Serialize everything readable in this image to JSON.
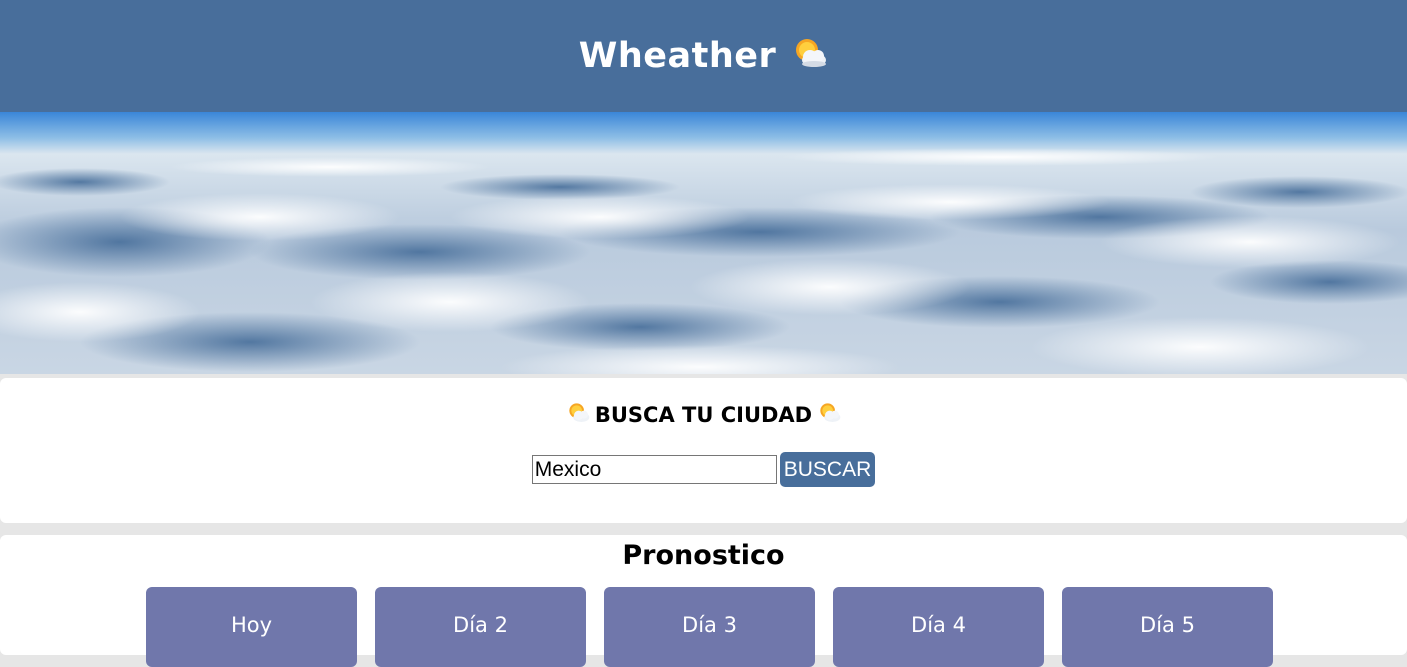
{
  "header": {
    "title": "Wheather",
    "icon": "sun-behind-cloud-icon"
  },
  "hero": {
    "icon": "clouds-above-image"
  },
  "search": {
    "title": "BUSCA TU CIUDAD",
    "input_value": "Mexico",
    "button_label": "BUSCAR"
  },
  "forecast": {
    "title": "Pronostico",
    "days": [
      {
        "label": "Hoy"
      },
      {
        "label": "Día 2"
      },
      {
        "label": "Día 3"
      },
      {
        "label": "Día 4"
      },
      {
        "label": "Día 5"
      }
    ]
  },
  "colors": {
    "header_bg": "#486e9b",
    "button_bg": "#486e9b",
    "day_card_bg": "#7077ab"
  }
}
